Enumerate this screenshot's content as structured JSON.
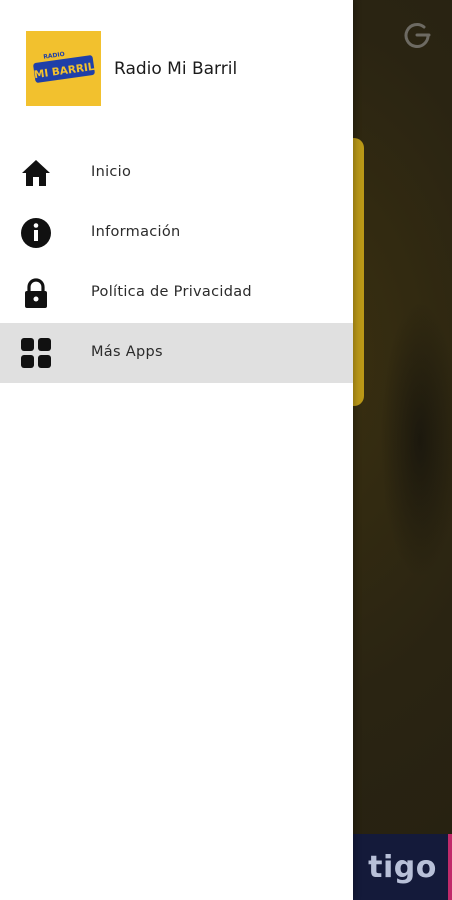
{
  "app": {
    "name": "Radio Mi Barril",
    "logo_text": "MI BARRIL",
    "logo_color": "#f2c12e"
  },
  "menu": {
    "items": [
      {
        "label": "Inicio",
        "icon": "home-icon"
      },
      {
        "label": "Información",
        "icon": "info-icon"
      },
      {
        "label": "Política de Privacidad",
        "icon": "lock-icon"
      },
      {
        "label": "Más Apps",
        "icon": "apps-grid-icon",
        "selected": true
      }
    ]
  },
  "background": {
    "banner_text": "tigo",
    "power_icon": "power-icon"
  }
}
